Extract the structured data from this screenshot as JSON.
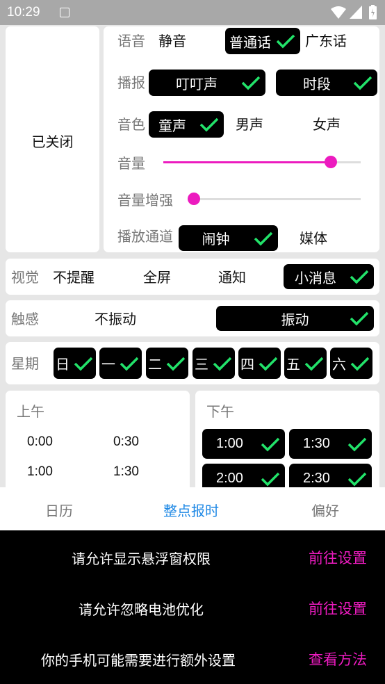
{
  "status_bar": {
    "time": "10:29"
  },
  "power_card": {
    "label": "已关闭"
  },
  "voice": {
    "label": "语音",
    "options": [
      "静音",
      "普通话",
      "广东话"
    ],
    "selected": "普通话"
  },
  "announce": {
    "label": "播报",
    "options": [
      "叮叮声",
      "时段"
    ]
  },
  "timbre": {
    "label": "音色",
    "options": [
      "童声",
      "男声",
      "女声"
    ],
    "selected": "童声"
  },
  "volume": {
    "label": "音量",
    "level_percent": 85
  },
  "volume_boost": {
    "label": "音量增强",
    "level_percent": 0
  },
  "channel": {
    "label": "播放通道",
    "options": [
      "闹钟",
      "媒体"
    ],
    "selected": "闹钟"
  },
  "visual": {
    "label": "视觉",
    "options": [
      "不提醒",
      "全屏",
      "通知",
      "小消息"
    ],
    "selected": "小消息"
  },
  "haptic": {
    "label": "触感",
    "options": [
      "不振动",
      "振动"
    ],
    "selected": "振动"
  },
  "week": {
    "label": "星期",
    "days": [
      "日",
      "一",
      "二",
      "三",
      "四",
      "五",
      "六"
    ]
  },
  "morning": {
    "label": "上午",
    "times": [
      "0:00",
      "0:30",
      "1:00",
      "1:30"
    ]
  },
  "afternoon": {
    "label": "下午",
    "times": [
      "1:00",
      "1:30",
      "2:00",
      "2:30"
    ]
  },
  "tabs": {
    "items": [
      "日历",
      "整点报时",
      "偏好"
    ],
    "active": "整点报时"
  },
  "permissions": [
    {
      "text": "请允许显示悬浮窗权限",
      "action": "前往设置"
    },
    {
      "text": "请允许忽略电池优化",
      "action": "前往设置"
    },
    {
      "text": "你的手机可能需要进行额外设置",
      "action": "查看方法"
    }
  ],
  "colors": {
    "accent": "#ec1bbf",
    "check": "#22e36a",
    "active_tab": "#1e88e5",
    "pill": "#000000"
  }
}
